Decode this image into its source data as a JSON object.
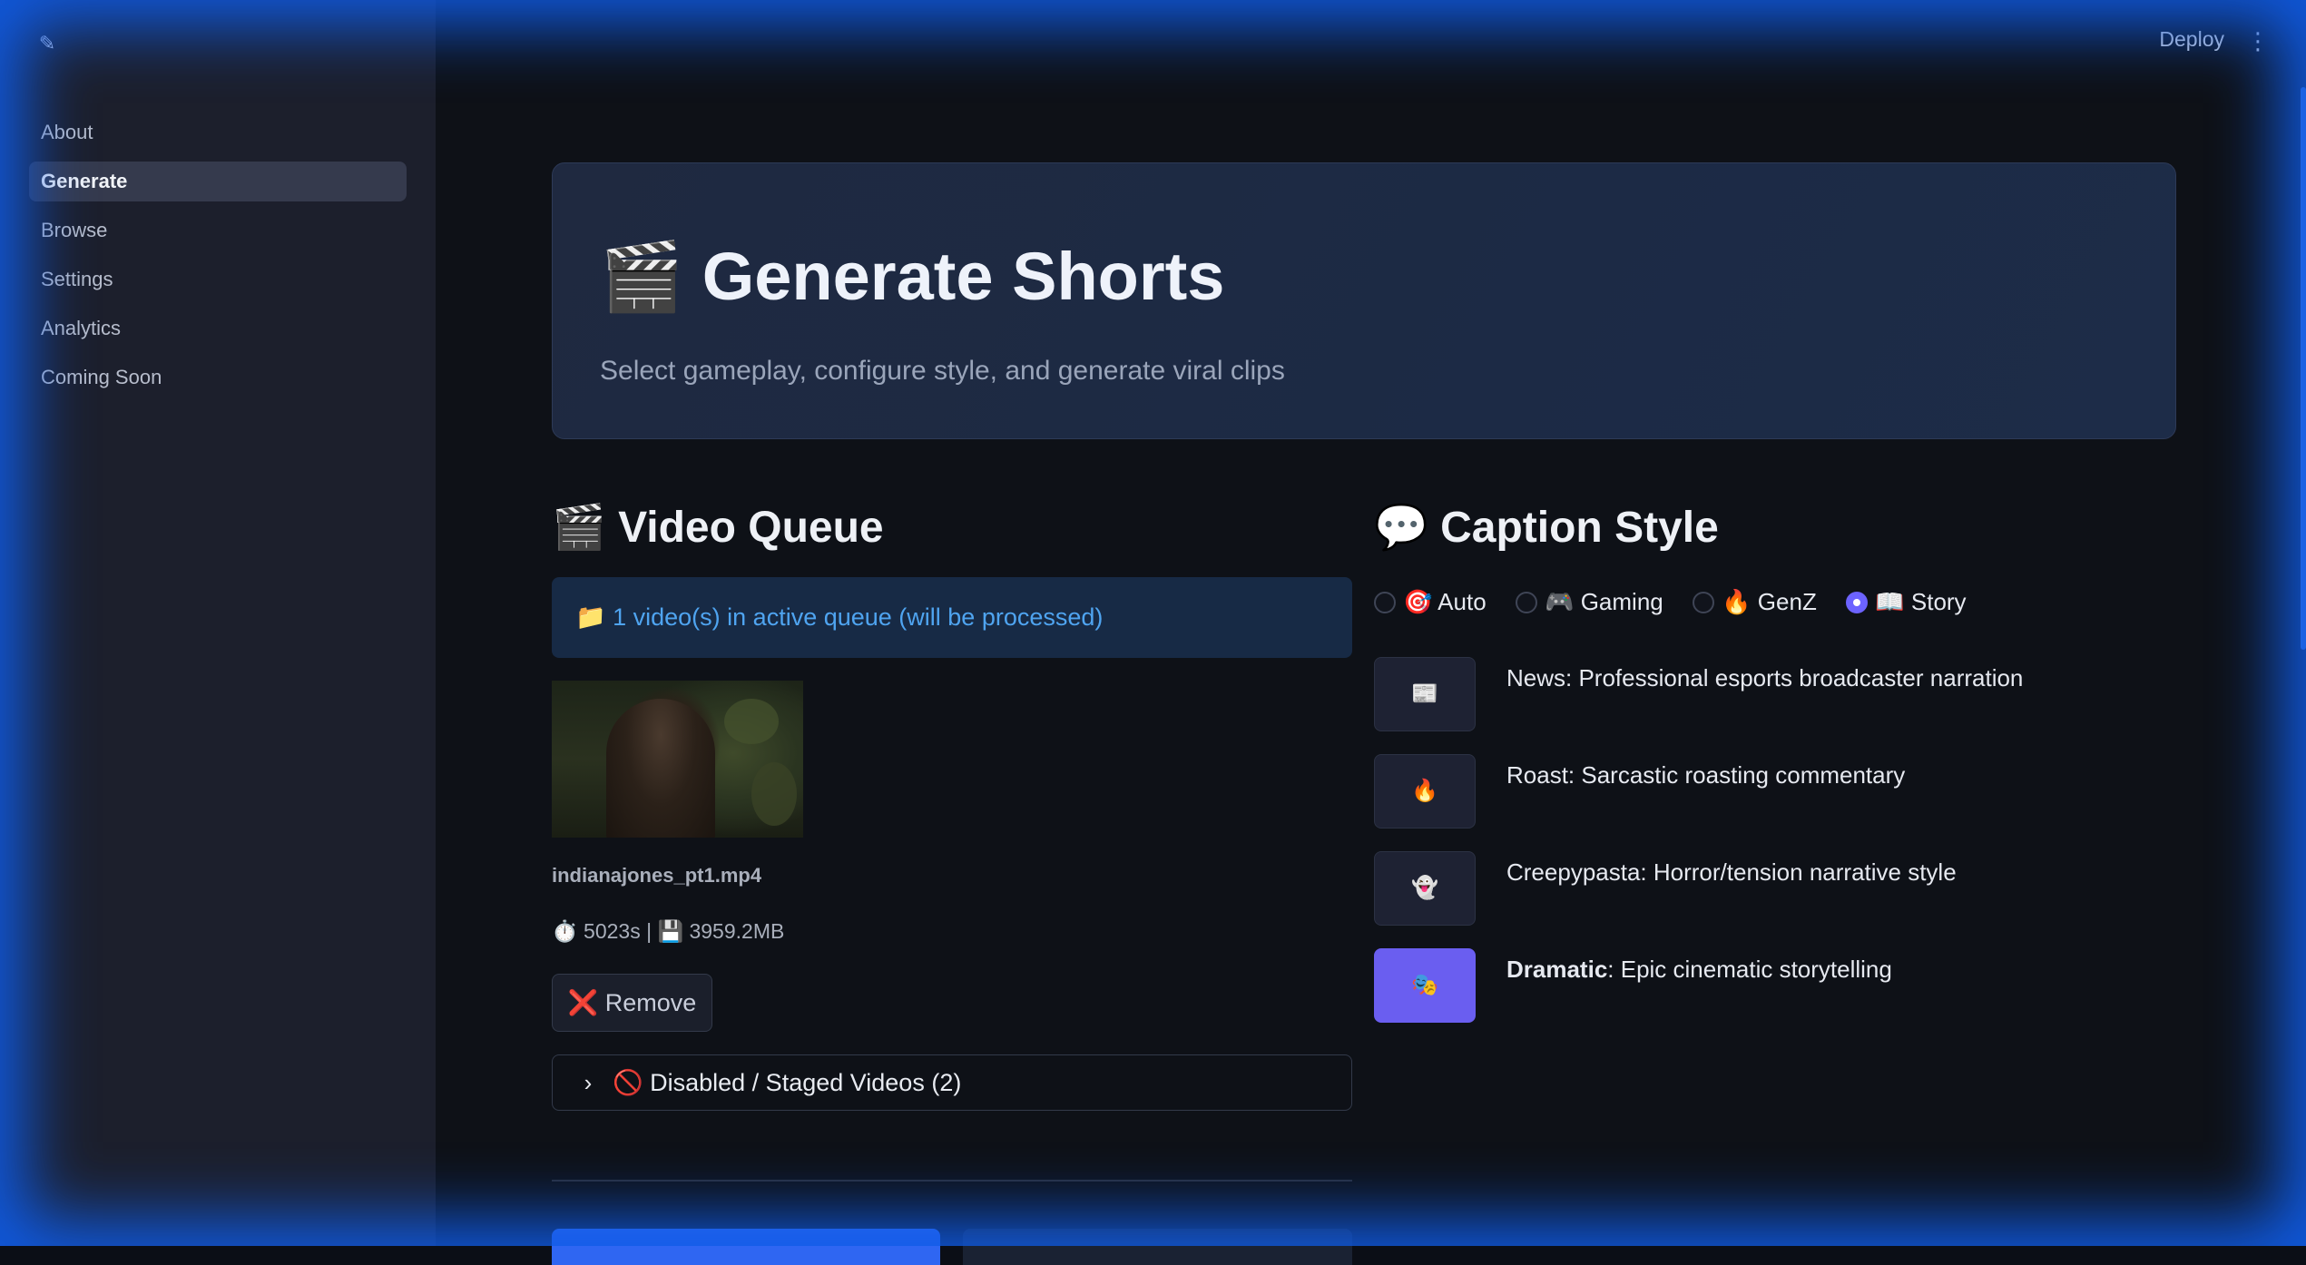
{
  "app": {
    "logo_glyph": "✎",
    "deploy_label": "Deploy",
    "menu_glyph": "⋮"
  },
  "sidebar": {
    "items": [
      {
        "label": "About",
        "active": false
      },
      {
        "label": "Generate",
        "active": true
      },
      {
        "label": "Browse",
        "active": false
      },
      {
        "label": "Settings",
        "active": false
      },
      {
        "label": "Analytics",
        "active": false
      },
      {
        "label": "Coming Soon",
        "active": false
      }
    ]
  },
  "hero": {
    "title": "🎬 Generate Shorts",
    "subtitle": "Select gameplay, configure style, and generate viral clips"
  },
  "video_queue": {
    "heading": "🎬 Video Queue",
    "info": "📁 1 video(s) in active queue (will be processed)",
    "video": {
      "filename": "indianajones_pt1.mp4",
      "meta": "⏱️ 5023s | 💾 3959.2MB"
    },
    "remove_label": "❌ Remove",
    "disabled_expander": "🚫 Disabled / Staged Videos (2)"
  },
  "caption_style": {
    "heading": "💬 Caption Style",
    "options": [
      {
        "label": "🎯 Auto",
        "selected": false
      },
      {
        "label": "🎮 Gaming",
        "selected": false
      },
      {
        "label": "🔥 GenZ",
        "selected": false
      },
      {
        "label": "📖 Story",
        "selected": true
      }
    ],
    "styles": [
      {
        "icon": "📰",
        "name": "News",
        "desc": ": Professional esports broadcaster narration",
        "active": false
      },
      {
        "icon": "🔥",
        "name": "Roast",
        "desc": ": Sarcastic roasting commentary",
        "active": false
      },
      {
        "icon": "👻",
        "name": "Creepypasta",
        "desc": ": Horror/tension narrative style",
        "active": false
      },
      {
        "icon": "🎭",
        "name": "Dramatic",
        "desc": ": Epic cinematic storytelling",
        "active": true
      }
    ]
  },
  "colors": {
    "accent": "#6a5ef0",
    "primary_button": "#2f66f2",
    "info_text": "#4fa4f0",
    "frame_glow": "#105ce6"
  }
}
